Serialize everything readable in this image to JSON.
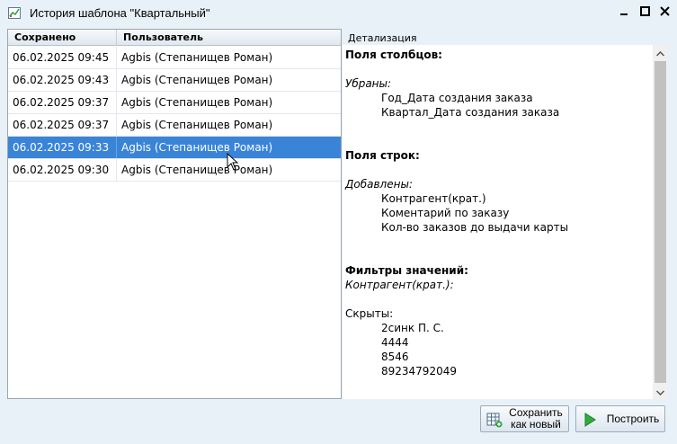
{
  "window": {
    "title": "История шаблона \"Квартальный\""
  },
  "grid": {
    "columns": [
      "Сохранено",
      "Пользователь"
    ],
    "rows": [
      {
        "saved": "06.02.2025  09:45",
        "user": "Agbis (Степанищев Роман)",
        "selected": false
      },
      {
        "saved": "06.02.2025  09:43",
        "user": "Agbis (Степанищев Роман)",
        "selected": false
      },
      {
        "saved": "06.02.2025  09:37",
        "user": "Agbis (Степанищев Роман)",
        "selected": false
      },
      {
        "saved": "06.02.2025  09:37",
        "user": "Agbis (Степанищев Роман)",
        "selected": false
      },
      {
        "saved": "06.02.2025  09:33",
        "user": "Agbis (Степанищев Роман)",
        "selected": true
      },
      {
        "saved": "06.02.2025  09:30",
        "user": "Agbis (Степанищев Роман)",
        "selected": false
      }
    ]
  },
  "detail": {
    "label": "Детализация",
    "columns_head": "Поля столбцов:",
    "removed_label": "Убраны:",
    "removed_items": [
      "Год_Дата создания заказа",
      "Квартал_Дата создания заказа"
    ],
    "rows_head": "Поля строк:",
    "added_label": "Добавлены:",
    "added_items": [
      "Контрагент(крат.)",
      "Коментарий по заказу",
      "Кол-во заказов до выдачи карты"
    ],
    "filters_head": "Фильтры значений:",
    "filter_field": "Контрагент(крат.):",
    "hidden_label": "Скрыты:",
    "hidden_items": [
      "2синк П. С.",
      "4444",
      "8546",
      "89234792049"
    ]
  },
  "buttons": {
    "save_line1": "Сохранить",
    "save_line2": "как новый",
    "build": "Построить"
  },
  "colors": {
    "selection": "#3a84d8",
    "window_bg": "#e8f1f8"
  },
  "icons": {
    "app": "chart-icon",
    "minimize": "minimize-icon",
    "maximize": "maximize-icon",
    "close": "close-icon",
    "save": "table-add-icon",
    "build": "play-icon"
  }
}
